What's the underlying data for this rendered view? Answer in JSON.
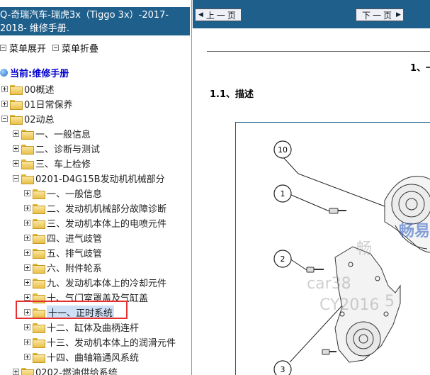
{
  "left_panel": {
    "title_line1": "Q-奇瑞汽车-瑞虎3x（Tiggo 3x）-2017-",
    "title_line2": "2018- 维修手册.",
    "expand_label": "菜单展开",
    "collapse_label": "菜单折叠",
    "current_label": "当前:维修手册",
    "tree": [
      {
        "label": "00概述",
        "level": 0,
        "expanded": false
      },
      {
        "label": "01日常保养",
        "level": 0,
        "expanded": false
      },
      {
        "label": "02动总",
        "level": 0,
        "expanded": true
      },
      {
        "label": "一、一般信息",
        "level": 1,
        "expanded": false
      },
      {
        "label": "二、诊断与测试",
        "level": 1,
        "expanded": false
      },
      {
        "label": "三、车上检修",
        "level": 1,
        "expanded": false
      },
      {
        "label": "0201-D4G15B发动机机械部分",
        "level": 1,
        "expanded": true
      },
      {
        "label": "一、一般信息",
        "level": 2,
        "expanded": false
      },
      {
        "label": "二、发动机机械部分故障诊断",
        "level": 2,
        "expanded": false
      },
      {
        "label": "三、发动机本体上的电喷元件",
        "level": 2,
        "expanded": false
      },
      {
        "label": "四、进气歧管",
        "level": 2,
        "expanded": false
      },
      {
        "label": "五、排气歧管",
        "level": 2,
        "expanded": false
      },
      {
        "label": "六、附件轮系",
        "level": 2,
        "expanded": false
      },
      {
        "label": "九、发动机本体上的冷却元件",
        "level": 2,
        "expanded": false
      },
      {
        "label": "十、气门室罩盖及气缸盖",
        "level": 2,
        "expanded": false
      },
      {
        "label": "十一、正时系统",
        "level": 2,
        "expanded": false,
        "selected": true
      },
      {
        "label": "十二、缸体及曲柄连杆",
        "level": 2,
        "expanded": false
      },
      {
        "label": "十三、发动机本体上的润滑元件",
        "level": 2,
        "expanded": false
      },
      {
        "label": "十四、曲轴箱通风系统",
        "level": 2,
        "expanded": false
      },
      {
        "label": "0202-燃油供给系统",
        "level": 1,
        "expanded": false
      }
    ]
  },
  "right_panel": {
    "prev_label": "上一页",
    "next_label": "下一页",
    "chapter_heading": "1、一",
    "section_heading": "1.1、描述",
    "callouts": [
      "10",
      "1",
      "2",
      "3"
    ],
    "watermarks": [
      "畅",
      "car38",
      "CY2016",
      "5",
      "畅易"
    ]
  },
  "colors": {
    "title_bar": "#1e5f8c",
    "highlight_box": "#e53030",
    "current_text": "#0000cc"
  }
}
